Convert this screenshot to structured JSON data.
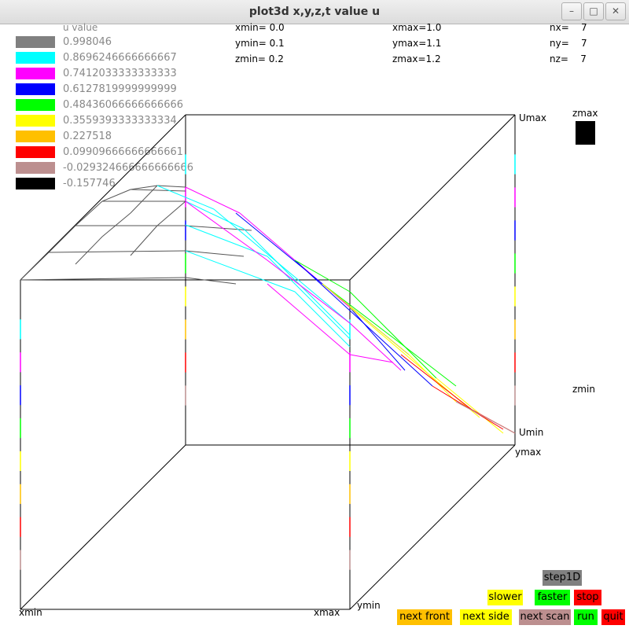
{
  "window": {
    "title": "plot3d x,y,z,t  value u"
  },
  "header": {
    "xmin": "xmin= 0.0",
    "ymin": "ymin= 0.1",
    "zmin": "zmin= 0.2",
    "xmax": "xmax=1.0",
    "ymax": "ymax=1.1",
    "zmax": "zmax=1.2",
    "nx": "nx=    7",
    "ny": "ny=    7",
    "nz": "nz=    7"
  },
  "legend": {
    "title": "u value",
    "items": [
      {
        "label": "0.998046",
        "color": "#808080"
      },
      {
        "label": "0.8696246666666667",
        "color": "#00ffff"
      },
      {
        "label": "0.7412033333333333",
        "color": "#ff00ff"
      },
      {
        "label": "0.6127819999999999",
        "color": "#0000ff"
      },
      {
        "label": "0.48436066666666666",
        "color": "#00ff00"
      },
      {
        "label": "0.3559393333333334",
        "color": "#ffff00"
      },
      {
        "label": "0.227518",
        "color": "#ffc000"
      },
      {
        "label": "0.09909666666666661",
        "color": "#ff0000"
      },
      {
        "label": "-0.029324666666666666",
        "color": "#bc8f8f"
      },
      {
        "label": "-0.157746",
        "color": "#000000"
      }
    ]
  },
  "axes": {
    "umax": "Umax",
    "umin": "Umin",
    "zmax": "zmax",
    "zmin": "zmin",
    "ymax": "ymax",
    "ymin": "ymin",
    "xmin": "xmin",
    "xmax": "xmax"
  },
  "controls": {
    "step1d": {
      "label": "step1D",
      "color": "#808080"
    },
    "slower": {
      "label": "slower",
      "color": "#ffff00"
    },
    "faster": {
      "label": "faster",
      "color": "#00ff00"
    },
    "stop": {
      "label": "stop",
      "color": "#ff0000"
    },
    "next_front": {
      "label": "next front",
      "color": "#ffc000"
    },
    "next_side": {
      "label": "next side",
      "color": "#ffff00"
    },
    "next_scan": {
      "label": "next scan",
      "color": "#bc8f8f"
    },
    "run": {
      "label": "run",
      "color": "#00ff00"
    },
    "quit": {
      "label": "quit",
      "color": "#ff0000"
    }
  }
}
